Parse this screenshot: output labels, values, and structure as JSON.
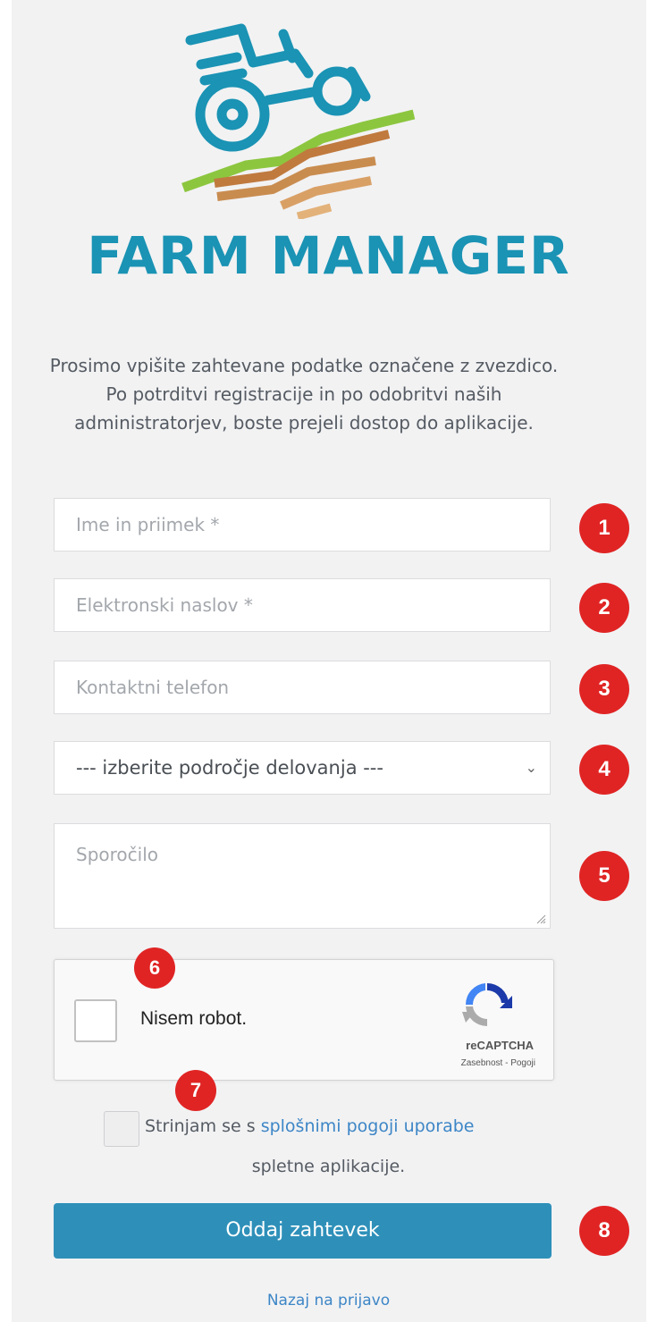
{
  "brand": {
    "name": "FARM MANAGER",
    "logo_icon": "tractor-on-field-logo",
    "colors": {
      "teal": "#1a93b4",
      "green": "#8cc63f",
      "brown": "#c07a3e",
      "tan": "#d9a066"
    }
  },
  "intro_text": "Prosimo vpišite zahtevane podatke označene z zvezdico. Po potrditvi registracije in po odobritvi naših administratorjev, boste prejeli dostop do aplikacije.",
  "form": {
    "name_placeholder": "Ime in priimek *",
    "email_placeholder": "Elektronski naslov *",
    "phone_placeholder": "Kontaktni telefon",
    "activity_selected": "--- izberite področje delovanja ---",
    "message_placeholder": "Sporočilo"
  },
  "captcha": {
    "label": "Nisem robot.",
    "brand": "reCAPTCHA",
    "links": "Zasebnost - Pogoji"
  },
  "agree": {
    "prefix": "Strinjam se s ",
    "link": "splošnimi pogoji uporabe",
    "suffix": "spletne aplikacije."
  },
  "submit_label": "Oddaj zahtevek",
  "back_link": "Nazaj na prijavo",
  "badges": [
    "1",
    "2",
    "3",
    "4",
    "5",
    "6",
    "7",
    "8"
  ],
  "accent_colors": {
    "badge": "#e02424",
    "button": "#2e90b9",
    "link": "#3d86c6"
  }
}
